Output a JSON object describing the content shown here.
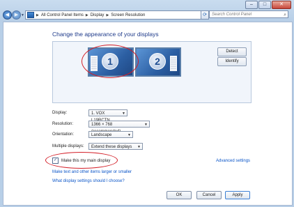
{
  "window": {
    "breadcrumbs": [
      "All Control Panel Items",
      "Display",
      "Screen Resolution"
    ],
    "search_placeholder": "Search Control Panel",
    "controls": {
      "minimize": "–",
      "maximize": "□",
      "close": "✕"
    }
  },
  "heading": "Change the appearance of your displays",
  "monitors": [
    {
      "number": "1"
    },
    {
      "number": "2"
    }
  ],
  "buttons": {
    "detect": "Detect",
    "identify": "Identify",
    "ok": "OK",
    "cancel": "Cancel",
    "apply": "Apply"
  },
  "form": {
    "display": {
      "label": "Display:",
      "value": "1. VOX L19RCTN"
    },
    "resolution": {
      "label": "Resolution:",
      "value": "1366 × 768 (recommended)"
    },
    "orientation": {
      "label": "Orientation:",
      "value": "Landscape"
    },
    "multiple": {
      "label": "Multiple displays:",
      "value": "Extend these displays"
    }
  },
  "main_display": {
    "label": "Make this my main display",
    "checked": true,
    "check_glyph": "✓"
  },
  "links": {
    "advanced": "Advanced settings",
    "larger": "Make text and other items larger or smaller",
    "settings": "What display settings should I choose?"
  },
  "colors": {
    "highlight": "#d31d26",
    "link": "#0a55c8",
    "heading": "#1e3a8a"
  }
}
